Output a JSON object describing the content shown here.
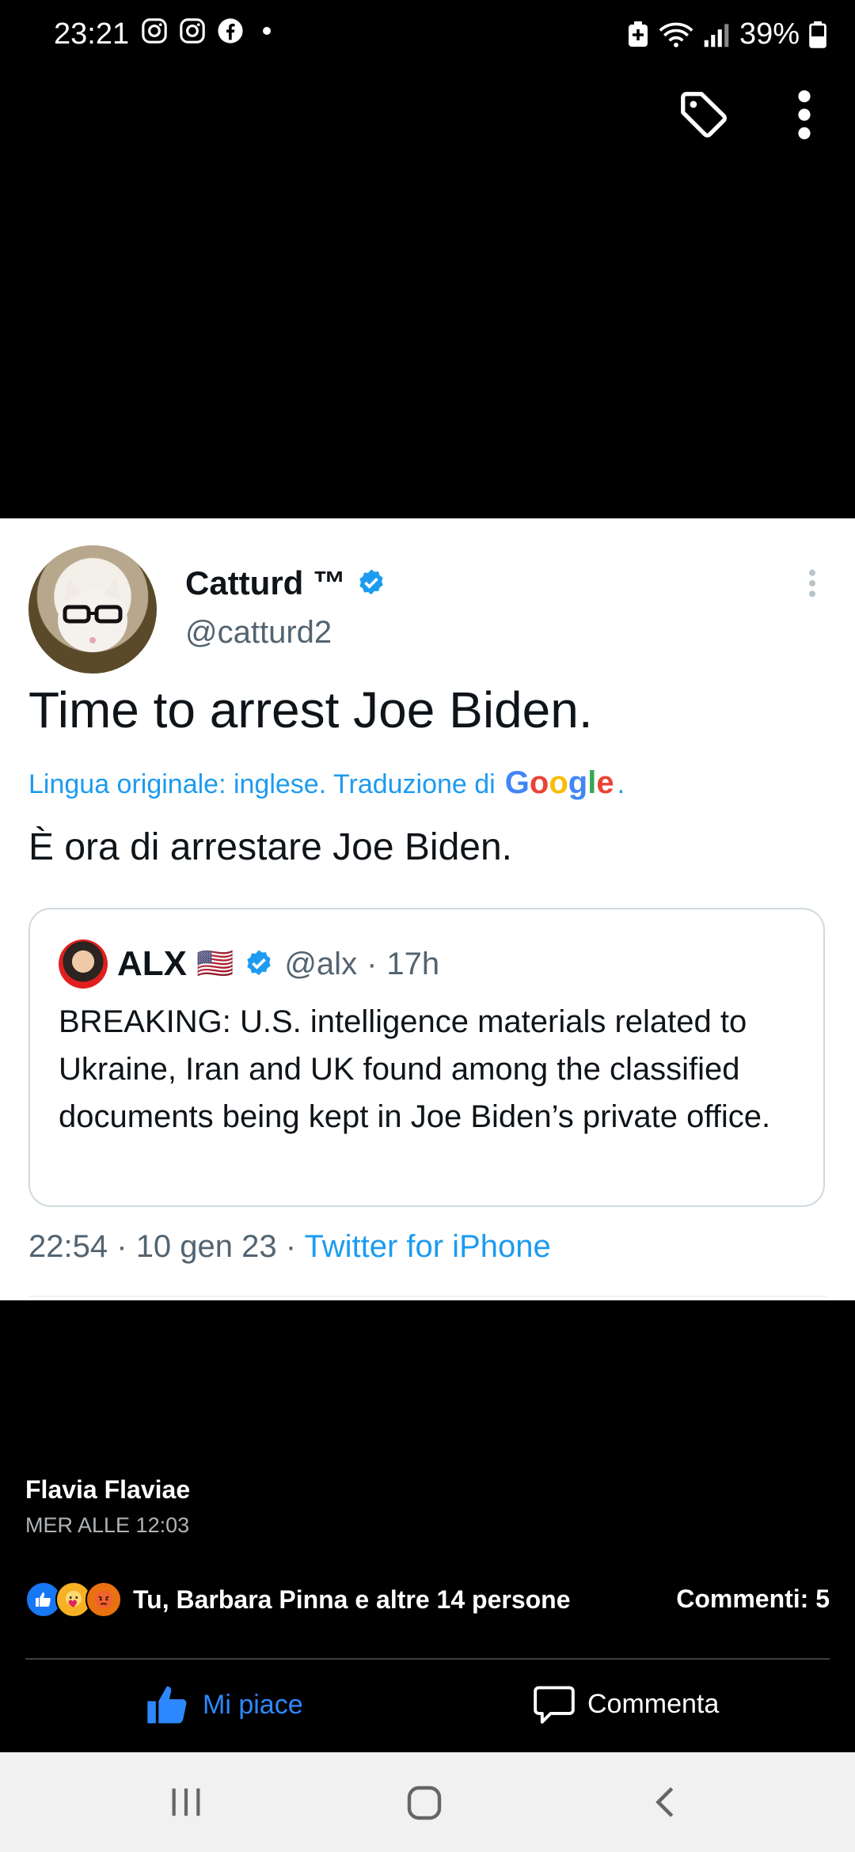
{
  "status_bar": {
    "time": "23:21",
    "app_icons": [
      "instagram-icon",
      "instagram-icon",
      "facebook-icon",
      "dot-icon"
    ],
    "battery": "39%",
    "system_icons": [
      "battery-saver-icon",
      "wifi-icon",
      "signal-icon",
      "battery-icon"
    ]
  },
  "top_actions": [
    "tag-icon",
    "more-vertical-icon"
  ],
  "tweet": {
    "display_name": "Catturd ™",
    "handle": "@catturd2",
    "text": "Time to arrest Joe Biden.",
    "translation_note": "Lingua originale: inglese. Traduzione di",
    "translation_brand": [
      "G",
      "o",
      "o",
      "g",
      "l",
      "e"
    ],
    "translation_brand_dot": ".",
    "translated_text": "È ora di arrestare Joe Biden.",
    "quote": {
      "name": "ALX",
      "flag": "🇺🇸",
      "handle": "@alx",
      "separator": "·",
      "age": "17h",
      "text": "BREAKING: U.S. intelligence materials related to Ukraine, Iran and UK found among the classified documents being kept in Joe Biden’s private office."
    },
    "time": "22:54",
    "date": "10 gen 23",
    "sep": "·",
    "source": "Twitter for iPhone"
  },
  "post": {
    "author": "Flavia Flaviae",
    "timestamp": "MER ALLE 12:03",
    "reactions_text": "Tu, Barbara Pinna e altre 14 persone",
    "comments_text": "Commenti: 5",
    "like_label": "Mi piace",
    "comment_label": "Commenta"
  },
  "colors": {
    "twitter_blue": "#1d9bf0",
    "facebook_blue": "#2d88ff",
    "google": [
      "#4285F4",
      "#EA4335",
      "#FBBC05",
      "#4285F4",
      "#34A853",
      "#EA4335"
    ]
  },
  "nav": [
    "recents-icon",
    "home-icon",
    "back-icon"
  ]
}
